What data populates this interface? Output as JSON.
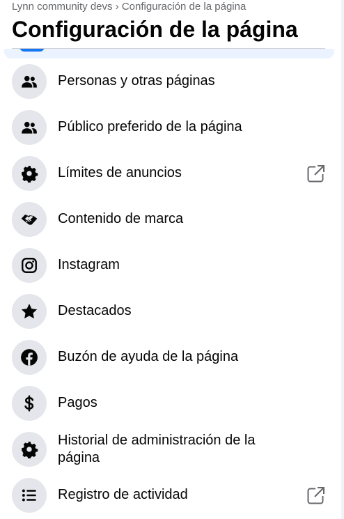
{
  "breadcrumb": "Lynn community devs › Configuración de la página",
  "title": "Configuración de la página",
  "items": [
    {
      "label": "Personas y otras páginas",
      "icon": "people-icon",
      "external": false
    },
    {
      "label": "Público preferido de la página",
      "icon": "people-icon",
      "external": false
    },
    {
      "label": "Límites de anuncios",
      "icon": "gear-icon",
      "external": true
    },
    {
      "label": "Contenido de marca",
      "icon": "handshake-icon",
      "external": false
    },
    {
      "label": "Instagram",
      "icon": "instagram-icon",
      "external": false
    },
    {
      "label": "Destacados",
      "icon": "star-icon",
      "external": false
    },
    {
      "label": "Buzón de ayuda de la página",
      "icon": "facebook-icon",
      "external": false
    },
    {
      "label": "Pagos",
      "icon": "dollar-icon",
      "external": false
    },
    {
      "label": "Historial de administración de la página",
      "icon": "gear-icon",
      "external": false
    },
    {
      "label": "Registro de actividad",
      "icon": "list-icon",
      "external": true
    }
  ],
  "colors": {
    "icon_bg": "#e4e6eb",
    "text": "#050505",
    "secondary": "#65676b",
    "accent": "#1877f2"
  }
}
